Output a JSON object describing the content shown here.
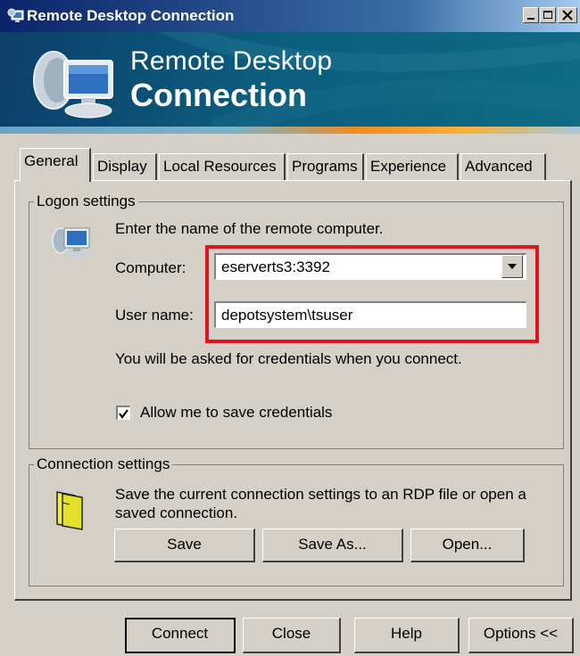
{
  "window": {
    "title": "Remote Desktop Connection",
    "icon": "remote-desktop-icon"
  },
  "banner": {
    "line1": "Remote Desktop",
    "line2": "Connection",
    "icon": "monitor-satellite-icon"
  },
  "tabs": [
    {
      "label": "General",
      "active": true
    },
    {
      "label": "Display",
      "active": false
    },
    {
      "label": "Local Resources",
      "active": false
    },
    {
      "label": "Programs",
      "active": false
    },
    {
      "label": "Experience",
      "active": false
    },
    {
      "label": "Advanced",
      "active": false
    }
  ],
  "logon": {
    "legend": "Logon settings",
    "instruction": "Enter the name of the remote computer.",
    "computer_label": "Computer:",
    "computer_value": "eserverts3:3392",
    "username_label": "User name:",
    "username_value": "depotsystem\\tsuser",
    "credentials_note": "You will be asked for credentials when you connect.",
    "save_credentials_label": "Allow me to save credentials",
    "save_credentials_checked": true
  },
  "connection": {
    "legend": "Connection settings",
    "description_line1": "Save the current connection settings to an RDP file or open a",
    "description_line2": "saved connection.",
    "save_label": "Save",
    "save_as_label": "Save As...",
    "open_label": "Open..."
  },
  "footer": {
    "connect_label": "Connect",
    "close_label": "Close",
    "help_label": "Help",
    "options_label": "Options <<"
  },
  "colors": {
    "highlight": "#e0141e",
    "titlebar": "#0a246a",
    "banner": "#0b5d7e",
    "dialog_face": "#d4d0c8"
  }
}
